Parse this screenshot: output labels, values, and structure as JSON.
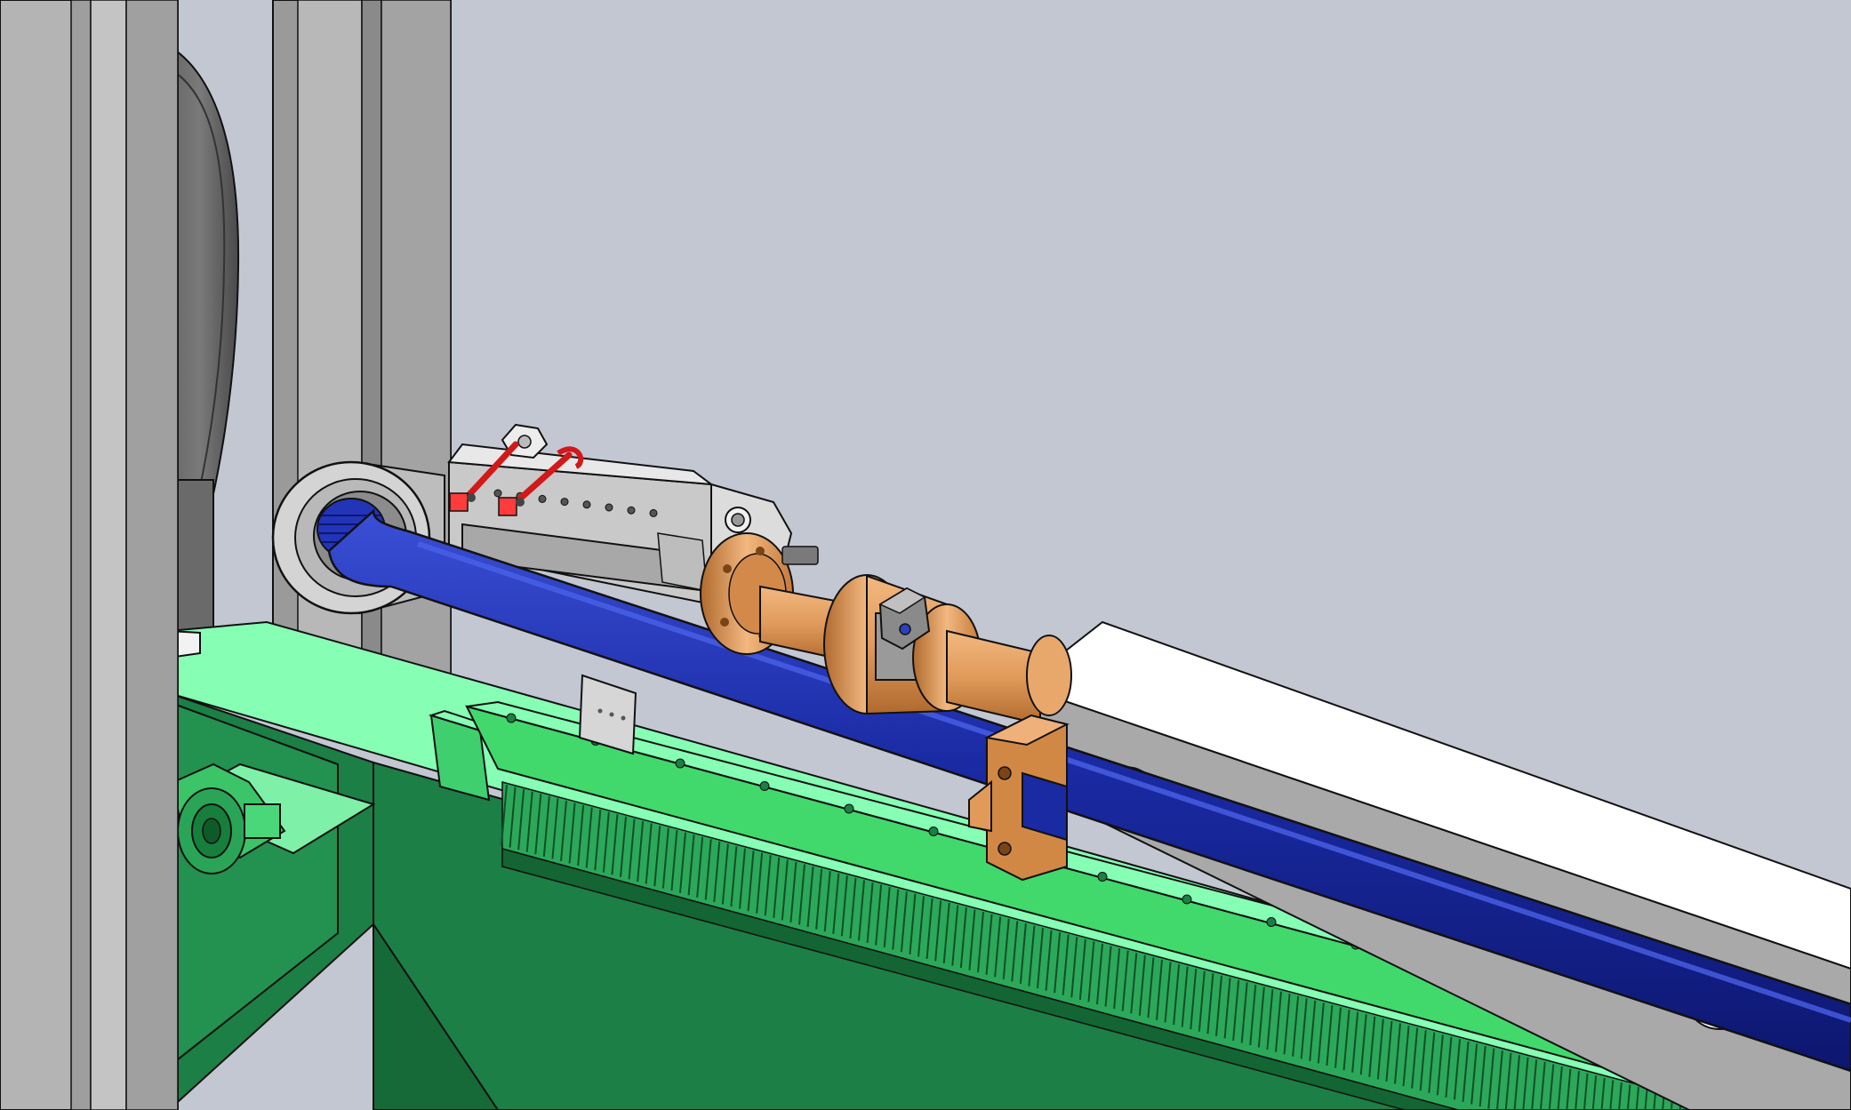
{
  "viewport": {
    "title": ""
  },
  "colors": {
    "background": "#c3c7d2",
    "frame_light": "#b4b4b4",
    "frame_mid": "#9a9a9a",
    "frame_dark": "#6e6e6e",
    "rail_light": "#86ffb4",
    "rail_mid": "#41d96b",
    "rail_dark": "#1c7f45",
    "rail_shadow": "#156a38",
    "hose_blue": "#1a2aa3",
    "hose_light": "#3a4fd6",
    "hose_dark": "#0d1770",
    "copper": "#e09a5a",
    "copper_light": "#f2b880",
    "copper_dark": "#b06a2e",
    "beam_top": "#ffffff",
    "beam_side": "#a9a9a9",
    "bracket": "#c9c9c9",
    "red": "#d21818",
    "outline": "#111111"
  },
  "components": [
    {
      "name": "vertical-frame-post-left",
      "icon": "steel-column-icon"
    },
    {
      "name": "vertical-frame-post-back",
      "icon": "steel-column-icon"
    },
    {
      "name": "rotating-disc",
      "icon": "disc-icon"
    },
    {
      "name": "green-base-frame",
      "icon": "frame-icon"
    },
    {
      "name": "gear-rack",
      "icon": "rack-gear-icon"
    },
    {
      "name": "pillow-block-bearing",
      "icon": "bearing-icon"
    },
    {
      "name": "blue-hose",
      "icon": "hose-icon"
    },
    {
      "name": "swivel-elbow",
      "icon": "elbow-icon"
    },
    {
      "name": "adjustable-bracket-plate",
      "icon": "bracket-icon"
    },
    {
      "name": "copper-flange-coupling",
      "icon": "coupling-icon"
    },
    {
      "name": "split-clamp-collar",
      "icon": "clamp-icon"
    },
    {
      "name": "hose-clamp-block",
      "icon": "clamp-block-icon"
    },
    {
      "name": "perforated-beam",
      "icon": "beam-icon"
    }
  ]
}
